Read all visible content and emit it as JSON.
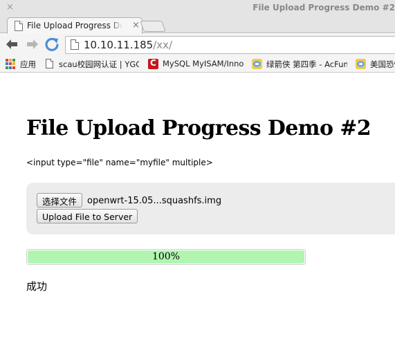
{
  "window": {
    "close_glyph": "×",
    "title": "File Upload Progress Demo #2"
  },
  "tab": {
    "title": "File Upload Progress Demo #2",
    "close_glyph": "×"
  },
  "omnibox": {
    "host": "10.10.11.185",
    "path": "/xx/"
  },
  "bookmarks": [
    {
      "label": "应用",
      "icon": "apps-grid-icon"
    },
    {
      "label": "scau校园网认证 | YGC",
      "icon": "page-icon"
    },
    {
      "label": "MySQL MyISAM/InnoDB",
      "icon": "c-logo-icon"
    },
    {
      "label": "绿箭侠 第四季 - AcFun",
      "icon": "acfun-icon"
    },
    {
      "label": "美国恐怖故事",
      "icon": "acfun-icon"
    }
  ],
  "page": {
    "title": "File Upload Progress Demo #2",
    "code_note": "<input type=\"file\" name=\"myfile\" multiple>",
    "choose_button": "选择文件",
    "file_name": "openwrt-15.05...squashfs.img",
    "upload_button": "Upload File to Server",
    "progress": {
      "percent": 100,
      "label": "100%"
    },
    "status": "成功"
  },
  "colors": {
    "progress_fill": "#b1f5b1",
    "upload_box_bg": "#ececec",
    "reload_icon": "#4a8fd8"
  }
}
